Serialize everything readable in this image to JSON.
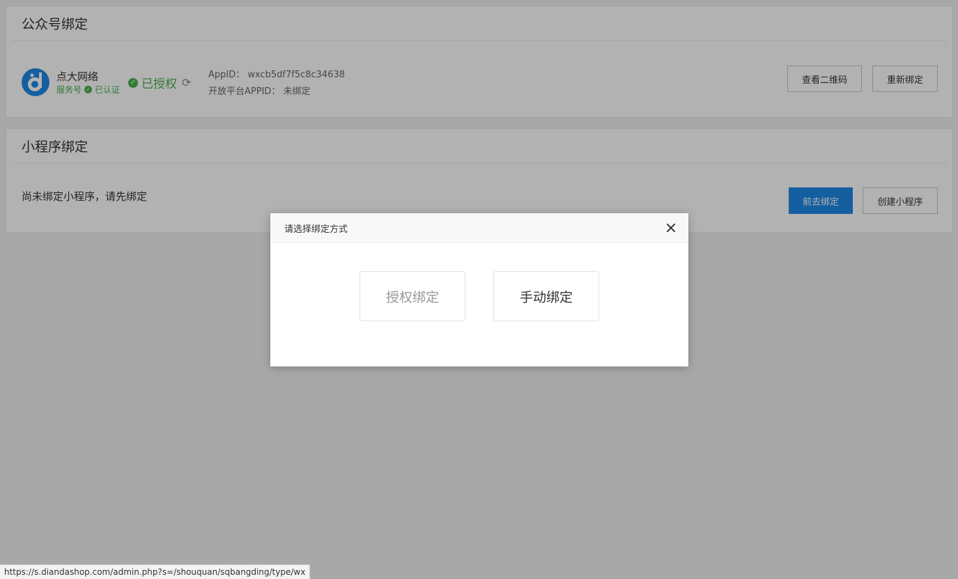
{
  "official_account": {
    "section_title": "公众号绑定",
    "name": "点大网络",
    "type_label": "服务号",
    "verified_label": "已认证",
    "auth_status": "已授权",
    "appid_text": "AppID： wxcb5df7f5c8c34638",
    "open_platform_text": "开放平台APPID： 未绑定",
    "view_qr_label": "查看二维码",
    "rebind_label": "重新绑定"
  },
  "mini_program": {
    "section_title": "小程序绑定",
    "empty_text": "尚未绑定小程序，请先绑定",
    "goto_bind_label": "前去绑定",
    "create_label": "创建小程序"
  },
  "modal": {
    "title": "请选择绑定方式",
    "option_auth": "授权绑定",
    "option_manual": "手动绑定"
  },
  "statusbar": {
    "url": "https://s.diandashop.com/admin.php?s=/shouquan/sqbangding/type/wx"
  },
  "colors": {
    "accent_blue": "#1e88e5",
    "success_green": "#4caf50"
  }
}
